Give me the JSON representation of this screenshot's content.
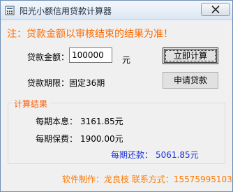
{
  "window": {
    "title": "阳光小额信用贷款计算器",
    "accent_color": "#ff6a00"
  },
  "notice": "注：贷款金额以审核结束的结果为准！",
  "form": {
    "amount_label": "贷款金额：",
    "amount_value": "100000",
    "amount_unit": "元",
    "period_label": "贷款期限：固定36期"
  },
  "buttons": {
    "calculate": "立即计算",
    "apply": "申请贷款"
  },
  "results": {
    "group_title": "计算结果",
    "interest_label": "每期本息：",
    "interest_value": "3161.85元",
    "fee_label": "每期保费：",
    "fee_value": "1900.00元",
    "total_label": "每期还款：",
    "total_value": "5061.85元"
  },
  "footer": "软件制作：龙良枝 联系方式：15575995103",
  "icons": {
    "app": "app-icon",
    "close": "close-icon"
  }
}
